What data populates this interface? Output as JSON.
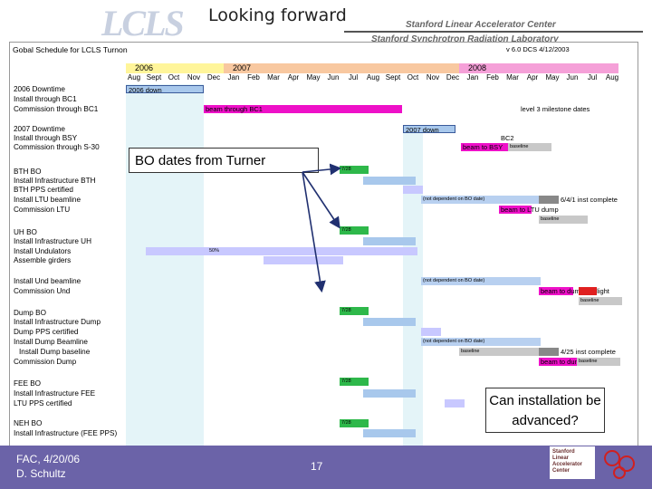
{
  "header": {
    "title": "Looking forward",
    "logo_text": "LCLS",
    "org1": "Stanford Linear Accelerator Center",
    "org2": "Stanford Synchrotron Radiation Laboratory"
  },
  "gantt": {
    "title": "Gobal Schedule for LCLS Turnon",
    "version": "v 6.0  DCS  4/12/2003",
    "years": [
      "2006",
      "2007",
      "2008"
    ],
    "months": [
      "Aug",
      "Sept",
      "Oct",
      "Nov",
      "Dec",
      "Jan",
      "Feb",
      "Mar",
      "Apr",
      "May",
      "Jun",
      "Jul",
      "Aug",
      "Sept",
      "Oct",
      "Nov",
      "Dec",
      "Jan",
      "Feb",
      "Mar",
      "Apr",
      "May",
      "Jun",
      "Jul",
      "Aug"
    ],
    "tasks": [
      "2006 Downtime",
      "Install through BC1",
      "Commission through BC1",
      "2007 Downtime",
      "Install through BSY",
      "Commission through S-30",
      "BTH BO",
      "Install Infrastructure BTH",
      "BTH PPS certified",
      "Install LTU beamline",
      "Commission LTU",
      "UH BO",
      "Install Infrastructure UH",
      "Install Undulators",
      "Assemble girders",
      "Install Und beamline",
      "Commission Und",
      "Dump BO",
      "Install Infrastructure Dump",
      "Dump PPS certified",
      "Install Dump Beamline",
      "Install Dump baseline",
      "Commission Dump",
      "FEE BO",
      "Install Infrastructure FEE",
      "LTU PPS certified",
      "NEH BO",
      "Install Infrastructure (FEE PPS)"
    ],
    "bar_labels": {
      "downtime_2006": "2006 down",
      "beam_bc1": "beam through BC1",
      "milestone_note": "level 3 milestone dates",
      "downtime_2007": "2007 down",
      "bc2": "BC2",
      "beam_bsy": "beam to BSY",
      "baseline": "baseline",
      "date_728": "7/28",
      "not_dependent": "(not dependent on BO date)",
      "ltu_complete": "6/4/1 inst complete",
      "beam_ltu": "beam to LTU dump",
      "pct_50": "50%",
      "beam_und": "beam to dump 1st light",
      "dump_complete": "4/25 inst complete",
      "beam_dump": "beam to dump"
    }
  },
  "callouts": {
    "bo_dates": "BO dates from Turner",
    "question": "Can installation be advanced?"
  },
  "footer": {
    "date": "FAC, 4/20/06",
    "author": "D. Schultz",
    "page": "17",
    "logo_text": "Stanford Linear Accelerator Center"
  }
}
